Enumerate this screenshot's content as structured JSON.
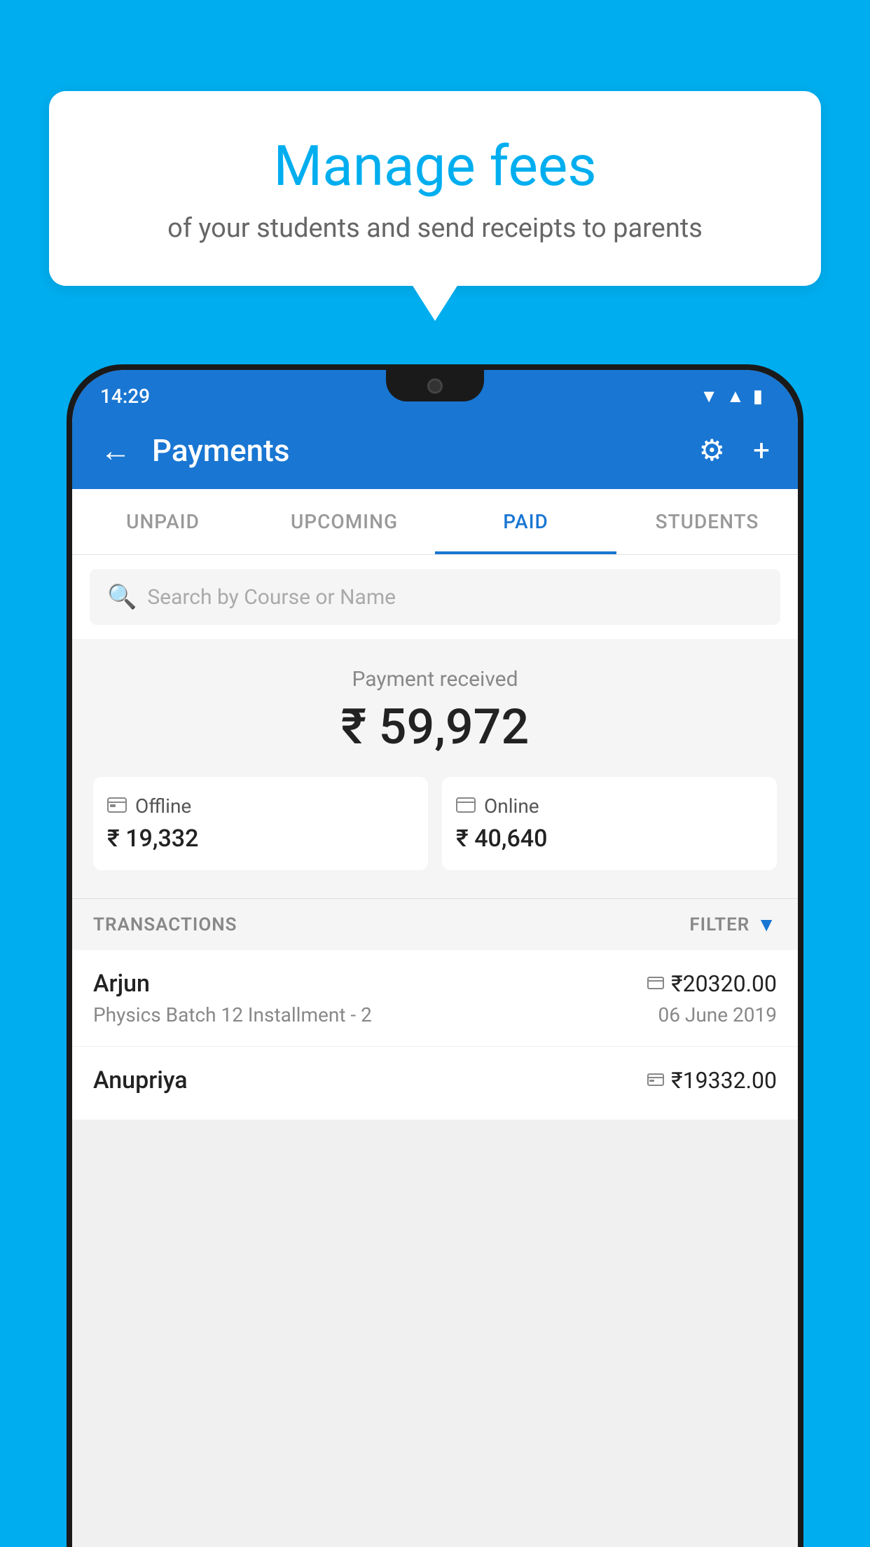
{
  "background_color": "#00AEEF",
  "bubble": {
    "title": "Manage fees",
    "subtitle": "of your students and send receipts to parents"
  },
  "status_bar": {
    "time": "14:29",
    "wifi_icon": "▲",
    "signal_icon": "▲",
    "battery_icon": "▮"
  },
  "app_bar": {
    "title": "Payments",
    "back_icon": "←",
    "gear_icon": "⚙",
    "plus_icon": "+"
  },
  "tabs": [
    {
      "label": "UNPAID",
      "active": false
    },
    {
      "label": "UPCOMING",
      "active": false
    },
    {
      "label": "PAID",
      "active": true
    },
    {
      "label": "STUDENTS",
      "active": false
    }
  ],
  "search": {
    "placeholder": "Search by Course or Name"
  },
  "payment_summary": {
    "label": "Payment received",
    "total": "₹ 59,972",
    "offline": {
      "icon": "💳",
      "label": "Offline",
      "amount": "₹ 19,332"
    },
    "online": {
      "icon": "💳",
      "label": "Online",
      "amount": "₹ 40,640"
    }
  },
  "transactions_header": {
    "label": "TRANSACTIONS",
    "filter_label": "FILTER"
  },
  "transactions": [
    {
      "name": "Arjun",
      "description": "Physics Batch 12 Installment - 2",
      "amount": "₹20320.00",
      "date": "06 June 2019",
      "method": "online"
    },
    {
      "name": "Anupriya",
      "description": "",
      "amount": "₹19332.00",
      "date": "",
      "method": "offline"
    }
  ]
}
